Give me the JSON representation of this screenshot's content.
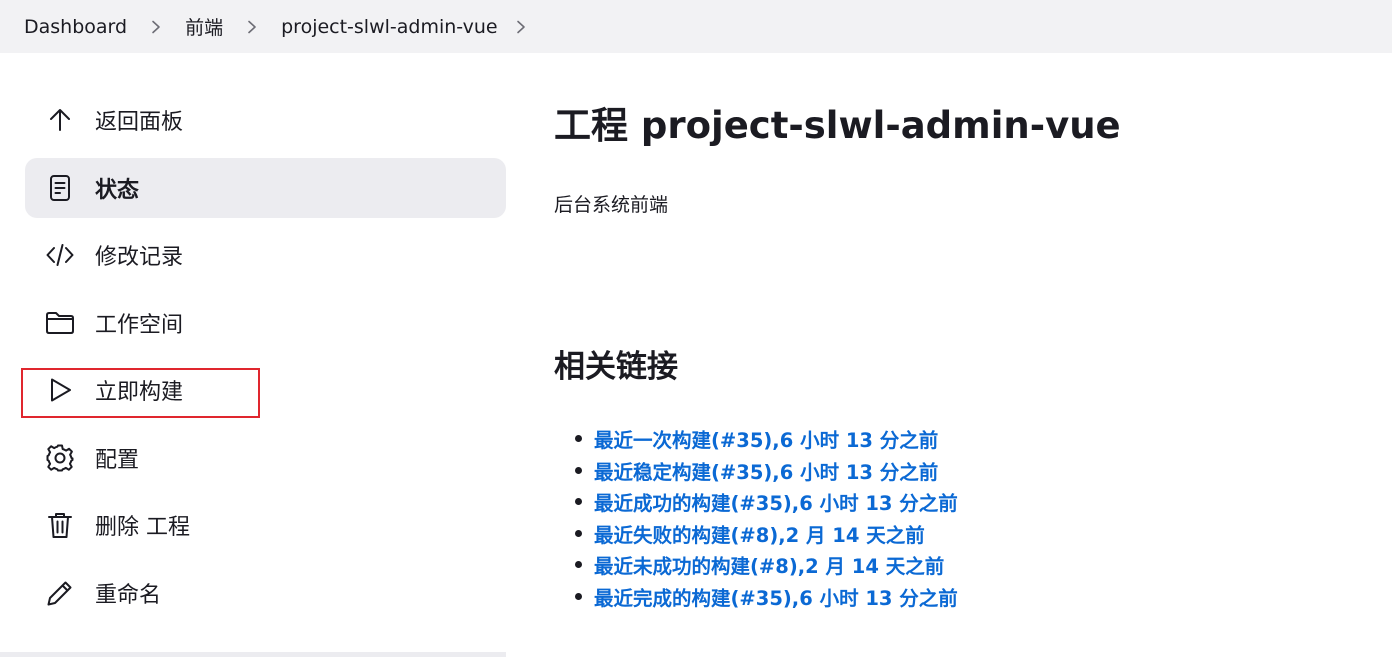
{
  "breadcrumb": {
    "items": [
      "Dashboard",
      "前端",
      "project-slwl-admin-vue"
    ]
  },
  "sidebar": {
    "items": [
      {
        "label": "返回面板",
        "icon": "arrow-up-icon"
      },
      {
        "label": "状态",
        "icon": "document-icon",
        "active": true
      },
      {
        "label": "修改记录",
        "icon": "code-icon"
      },
      {
        "label": "工作空间",
        "icon": "folder-icon"
      },
      {
        "label": "立即构建",
        "icon": "play-icon",
        "highlighted": true
      },
      {
        "label": "配置",
        "icon": "gear-icon"
      },
      {
        "label": "删除 工程",
        "icon": "trash-icon"
      },
      {
        "label": "重命名",
        "icon": "pencil-icon"
      }
    ]
  },
  "main": {
    "title": "工程 project-slwl-admin-vue",
    "description": "后台系统前端",
    "related_links_heading": "相关链接",
    "links": [
      "最近一次构建(#35),6 小时 13 分之前",
      "最近稳定构建(#35),6 小时 13 分之前",
      "最近成功的构建(#35),6 小时 13 分之前",
      "最近失败的构建(#8),2 月 14 天之前",
      "最近未成功的构建(#8),2 月 14 天之前",
      "最近完成的构建(#35),6 小时 13 分之前"
    ]
  },
  "colors": {
    "link": "#0b69d4",
    "highlight_border": "#e0262e",
    "active_bg": "#ececf0",
    "breadcrumb_bg": "#f2f2f4"
  }
}
